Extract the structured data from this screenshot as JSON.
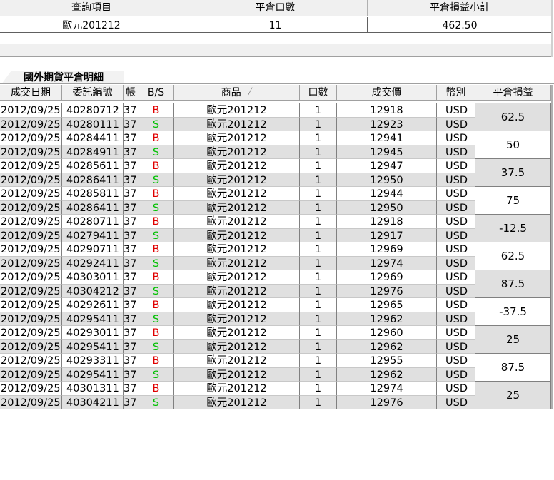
{
  "summary": {
    "headers": [
      "查詢項目",
      "平倉口數",
      "平倉損益小計"
    ],
    "row": {
      "item": "歐元201212",
      "lots": "11",
      "subtotal": "462.50"
    }
  },
  "tab": {
    "label": "國外期貨平倉明細"
  },
  "detail": {
    "headers": {
      "date": "成交日期",
      "order_no": "委託編號",
      "account": "帳",
      "bs": "B/S",
      "product": "商品",
      "qty": "口數",
      "price": "成交價",
      "currency": "幣別",
      "pnl": "平倉損益"
    },
    "account_partial": "37",
    "rows": [
      {
        "date": "2012/09/25",
        "order_no": "40280712",
        "bs": "B",
        "product": "歐元201212",
        "qty": "1",
        "price": "12918",
        "currency": "USD"
      },
      {
        "date": "2012/09/25",
        "order_no": "40280111",
        "bs": "S",
        "product": "歐元201212",
        "qty": "1",
        "price": "12923",
        "currency": "USD"
      },
      {
        "date": "2012/09/25",
        "order_no": "40284411",
        "bs": "B",
        "product": "歐元201212",
        "qty": "1",
        "price": "12941",
        "currency": "USD"
      },
      {
        "date": "2012/09/25",
        "order_no": "40284911",
        "bs": "S",
        "product": "歐元201212",
        "qty": "1",
        "price": "12945",
        "currency": "USD"
      },
      {
        "date": "2012/09/25",
        "order_no": "40285611",
        "bs": "B",
        "product": "歐元201212",
        "qty": "1",
        "price": "12947",
        "currency": "USD"
      },
      {
        "date": "2012/09/25",
        "order_no": "40286411",
        "bs": "S",
        "product": "歐元201212",
        "qty": "1",
        "price": "12950",
        "currency": "USD"
      },
      {
        "date": "2012/09/25",
        "order_no": "40285811",
        "bs": "B",
        "product": "歐元201212",
        "qty": "1",
        "price": "12944",
        "currency": "USD"
      },
      {
        "date": "2012/09/25",
        "order_no": "40286411",
        "bs": "S",
        "product": "歐元201212",
        "qty": "1",
        "price": "12950",
        "currency": "USD"
      },
      {
        "date": "2012/09/25",
        "order_no": "40280711",
        "bs": "B",
        "product": "歐元201212",
        "qty": "1",
        "price": "12918",
        "currency": "USD"
      },
      {
        "date": "2012/09/25",
        "order_no": "40279411",
        "bs": "S",
        "product": "歐元201212",
        "qty": "1",
        "price": "12917",
        "currency": "USD"
      },
      {
        "date": "2012/09/25",
        "order_no": "40290711",
        "bs": "B",
        "product": "歐元201212",
        "qty": "1",
        "price": "12969",
        "currency": "USD"
      },
      {
        "date": "2012/09/25",
        "order_no": "40292411",
        "bs": "S",
        "product": "歐元201212",
        "qty": "1",
        "price": "12974",
        "currency": "USD"
      },
      {
        "date": "2012/09/25",
        "order_no": "40303011",
        "bs": "B",
        "product": "歐元201212",
        "qty": "1",
        "price": "12969",
        "currency": "USD"
      },
      {
        "date": "2012/09/25",
        "order_no": "40304212",
        "bs": "S",
        "product": "歐元201212",
        "qty": "1",
        "price": "12976",
        "currency": "USD"
      },
      {
        "date": "2012/09/25",
        "order_no": "40292611",
        "bs": "B",
        "product": "歐元201212",
        "qty": "1",
        "price": "12965",
        "currency": "USD"
      },
      {
        "date": "2012/09/25",
        "order_no": "40295411",
        "bs": "S",
        "product": "歐元201212",
        "qty": "1",
        "price": "12962",
        "currency": "USD"
      },
      {
        "date": "2012/09/25",
        "order_no": "40293011",
        "bs": "B",
        "product": "歐元201212",
        "qty": "1",
        "price": "12960",
        "currency": "USD"
      },
      {
        "date": "2012/09/25",
        "order_no": "40295411",
        "bs": "S",
        "product": "歐元201212",
        "qty": "1",
        "price": "12962",
        "currency": "USD"
      },
      {
        "date": "2012/09/25",
        "order_no": "40293311",
        "bs": "B",
        "product": "歐元201212",
        "qty": "1",
        "price": "12955",
        "currency": "USD"
      },
      {
        "date": "2012/09/25",
        "order_no": "40295411",
        "bs": "S",
        "product": "歐元201212",
        "qty": "1",
        "price": "12962",
        "currency": "USD"
      },
      {
        "date": "2012/09/25",
        "order_no": "40301311",
        "bs": "B",
        "product": "歐元201212",
        "qty": "1",
        "price": "12974",
        "currency": "USD"
      },
      {
        "date": "2012/09/25",
        "order_no": "40304211",
        "bs": "S",
        "product": "歐元201212",
        "qty": "1",
        "price": "12976",
        "currency": "USD"
      }
    ],
    "pnl": [
      "62.5",
      "50",
      "37.5",
      "75",
      "-12.5",
      "62.5",
      "87.5",
      "-37.5",
      "25",
      "87.5",
      "25"
    ]
  },
  "colors": {
    "buy": "#e00000",
    "sell": "#00c000",
    "even_row": "#e0e0e0",
    "header_bg": "#f0f0f0"
  },
  "icons": {
    "sort": "sort-indicator-icon"
  }
}
